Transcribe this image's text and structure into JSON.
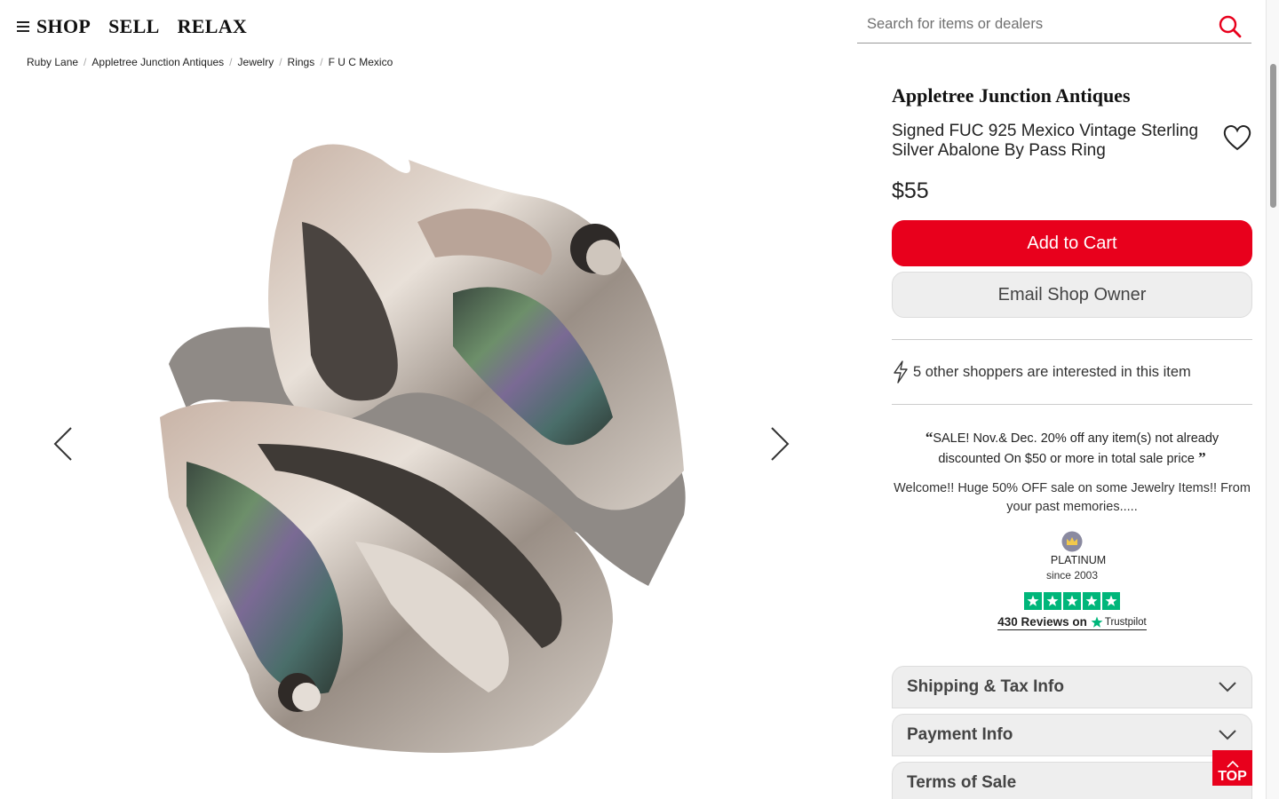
{
  "header": {
    "nav": [
      "SHOP",
      "SELL",
      "RELAX"
    ],
    "search_placeholder": "Search for items or dealers"
  },
  "breadcrumb": [
    "Ruby Lane",
    "Appletree Junction Antiques",
    "Jewelry",
    "Rings",
    "F U C Mexico"
  ],
  "item": {
    "shop_name": "Appletree Junction Antiques",
    "title": "Signed FUC 925 Mexico Vintage Sterling Silver Abalone By Pass Ring",
    "price": "$55",
    "add_to_cart": "Add to Cart",
    "email_owner": "Email Shop Owner",
    "interest": "5 other shoppers are interested in this item"
  },
  "shop_info": {
    "sale_text": "SALE! Nov.& Dec. 20% off any item(s) not already discounted On $50 or more in total sale price",
    "welcome": "Welcome!! Huge 50% OFF sale on some Jewelry Items!! From your past memories.....",
    "tier": "PLATINUM",
    "since": "since 2003",
    "reviews": "430 Reviews on",
    "trustpilot": "Trustpilot"
  },
  "accordions": [
    "Shipping & Tax Info",
    "Payment Info",
    "Terms of Sale"
  ],
  "top_label": "TOP",
  "colors": {
    "brand_red": "#e8001c",
    "trustpilot_green": "#00b67a"
  }
}
